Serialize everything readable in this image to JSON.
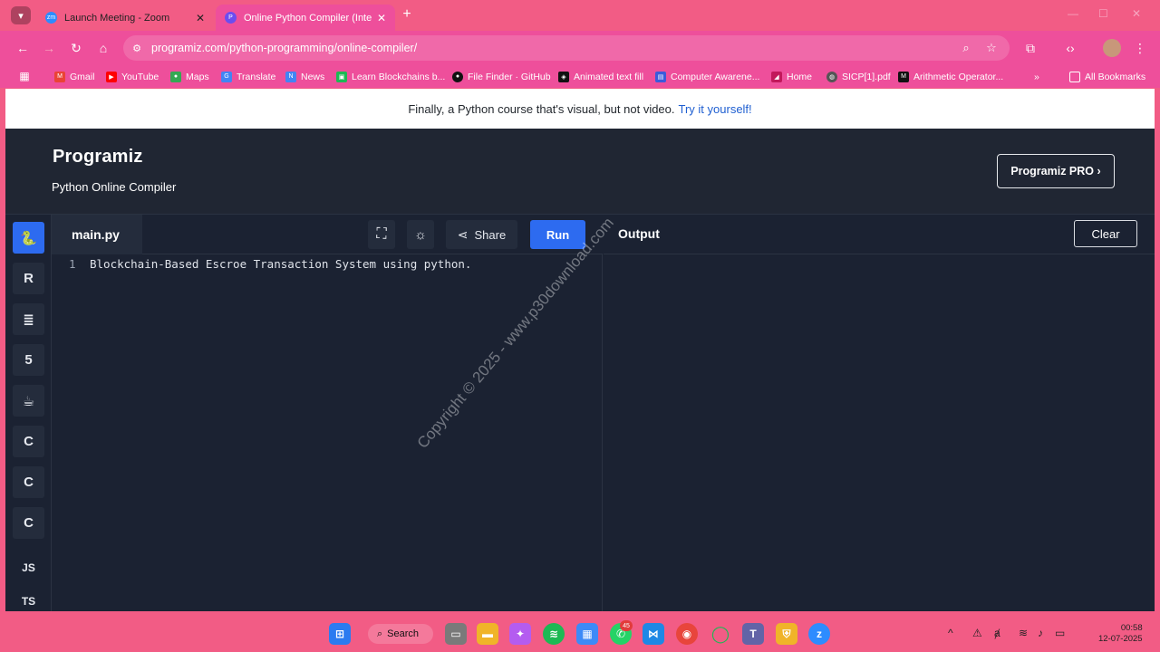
{
  "browser": {
    "tabs": [
      {
        "title": "Launch Meeting - Zoom",
        "favicon": "zoom-icon"
      },
      {
        "title": "Online Python Compiler (Interp",
        "favicon": "programiz-icon",
        "active": true
      }
    ],
    "url": "programiz.com/python-programming/online-compiler/",
    "bookmarks": [
      "Gmail",
      "YouTube",
      "Maps",
      "Translate",
      "News",
      "Learn Blockchains b...",
      "File Finder · GitHub",
      "Animated text fill",
      "Computer Awarene...",
      "Home",
      "SICP[1].pdf",
      "Arithmetic Operator..."
    ],
    "all_bookmarks": "All Bookmarks",
    "overflow": "»"
  },
  "banner": {
    "text": "Finally, a Python course that's visual, but not video.",
    "link": "Try it yourself!"
  },
  "header": {
    "logo": "Programiz",
    "subtitle": "Python Online Compiler",
    "pro_button": "Programiz PRO ›"
  },
  "languages": [
    "Python",
    "R",
    "SQL",
    "HTML",
    "Java",
    "C",
    "C++",
    "C#",
    "JS",
    "TS"
  ],
  "editor": {
    "file_name": "main.py",
    "share_label": "Share",
    "run_label": "Run",
    "lines": [
      {
        "number": "1",
        "text": "Blockchain-Based Escroe Transaction System using python."
      }
    ]
  },
  "output": {
    "title": "Output",
    "clear_label": "Clear"
  },
  "watermark": "Copyright © 2025 - www.p30download.com",
  "taskbar": {
    "search": "Search",
    "whatsapp_badge": "45",
    "time": "00:58",
    "date": "12-07-2025"
  },
  "colors": {
    "chrome": "#ee4f9b",
    "accent": "#2d6bf0",
    "page_bg": "#1b2232"
  }
}
